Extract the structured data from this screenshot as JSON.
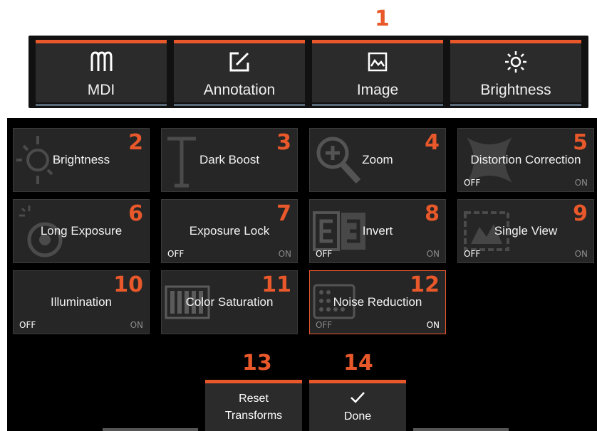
{
  "callouts": {
    "c1": "1",
    "c13": "13",
    "c14": "14"
  },
  "tabs": [
    {
      "label": "MDI",
      "icon": "mdi-icon"
    },
    {
      "label": "Annotation",
      "icon": "annotation-icon"
    },
    {
      "label": "Image",
      "icon": "image-icon"
    },
    {
      "label": "Brightness",
      "icon": "sun-icon"
    }
  ],
  "tiles": [
    {
      "label": "Brightness",
      "num": "2"
    },
    {
      "label": "Dark Boost",
      "num": "3"
    },
    {
      "label": "Zoom",
      "num": "4"
    },
    {
      "label": "Distortion Correction",
      "num": "5",
      "off": "OFF",
      "on": "ON"
    },
    {
      "label": "Long Exposure",
      "num": "6"
    },
    {
      "label": "Exposure Lock",
      "num": "7",
      "off": "OFF",
      "on": "ON"
    },
    {
      "label": "Invert",
      "num": "8",
      "off": "OFF",
      "on": "ON"
    },
    {
      "label": "Single View",
      "num": "9",
      "off": "OFF",
      "on": "ON"
    },
    {
      "label": "Illumination",
      "num": "10",
      "off": "OFF",
      "on": "ON"
    },
    {
      "label": "Color Saturation",
      "num": "11"
    },
    {
      "label": "Noise Reduction",
      "num": "12",
      "off": "OFF",
      "on": "ON",
      "state": "on"
    }
  ],
  "buttons": {
    "reset": {
      "line1": "Reset",
      "line2": "Transforms"
    },
    "done": {
      "label": "Done",
      "icon": "checkmark-icon"
    }
  },
  "colors": {
    "accent": "#e8582a",
    "tile": "#262626",
    "background": "#000000"
  }
}
